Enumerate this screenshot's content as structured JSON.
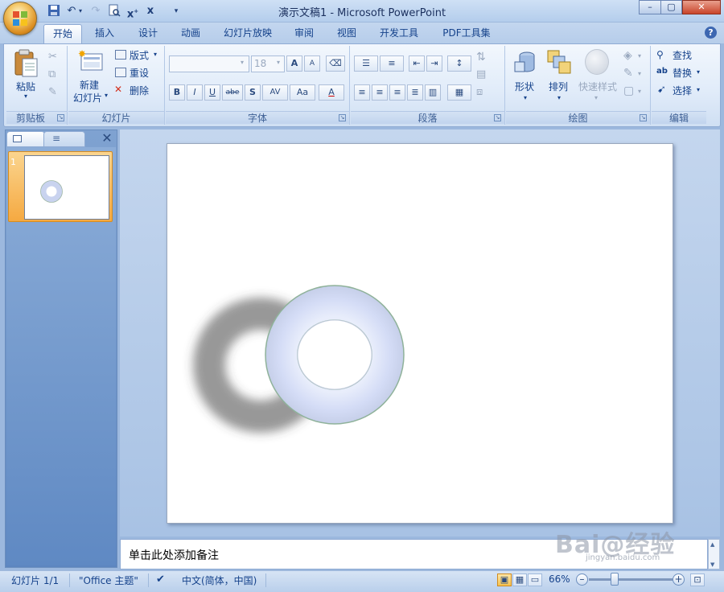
{
  "window": {
    "title": "演示文稿1 - Microsoft PowerPoint",
    "controls": {
      "minimize": "–",
      "restore": "▢",
      "close": "✕"
    }
  },
  "quick_access": [
    "save-icon",
    "undo-icon",
    "redo-icon",
    "print-preview-icon",
    "close-x-1",
    "close-x-2",
    "customize-dropdown"
  ],
  "tabs": [
    "开始",
    "插入",
    "设计",
    "动画",
    "幻灯片放映",
    "审阅",
    "视图",
    "开发工具",
    "PDF工具集"
  ],
  "active_tab": "开始",
  "help_icon": "?",
  "ribbon": {
    "clipboard": {
      "label": "剪贴板",
      "paste": "粘贴"
    },
    "slides": {
      "label": "幻灯片",
      "new_slide_line1": "新建",
      "new_slide_line2": "幻灯片",
      "layout": "版式",
      "reset": "重设",
      "delete": "删除"
    },
    "font": {
      "label": "字体",
      "font_name": "",
      "font_size": "18",
      "grow": "A",
      "shrink": "A",
      "bold": "B",
      "italic": "I",
      "underline": "U",
      "strike": "abe",
      "shadow": "S",
      "spacing": "AV",
      "case": "Aa",
      "color": "A"
    },
    "paragraph": {
      "label": "段落"
    },
    "drawing": {
      "label": "绘图",
      "shapes": "形状",
      "arrange": "排列",
      "quick_styles": "快速样式"
    },
    "editing": {
      "label": "编辑",
      "find": "查找",
      "replace": "替换",
      "select": "选择"
    }
  },
  "slide_pane": {
    "slide_number": "1"
  },
  "slide": {
    "shape": "donut",
    "fill": "#d9e1f7",
    "stroke": "#8fb29a"
  },
  "notes_placeholder": "单击此处添加备注",
  "status": {
    "slide_info": "幻灯片 1/1",
    "theme": "\"Office 主题\"",
    "language": "中文(简体，中国)",
    "zoom": "66%",
    "zoom_level": 0.66
  },
  "watermark": {
    "text": "Bai@经验",
    "sub": "jingyan.baidu.com"
  },
  "colors": {
    "ribbon_text": "#15428b",
    "accent_orange": "#f5a941"
  }
}
